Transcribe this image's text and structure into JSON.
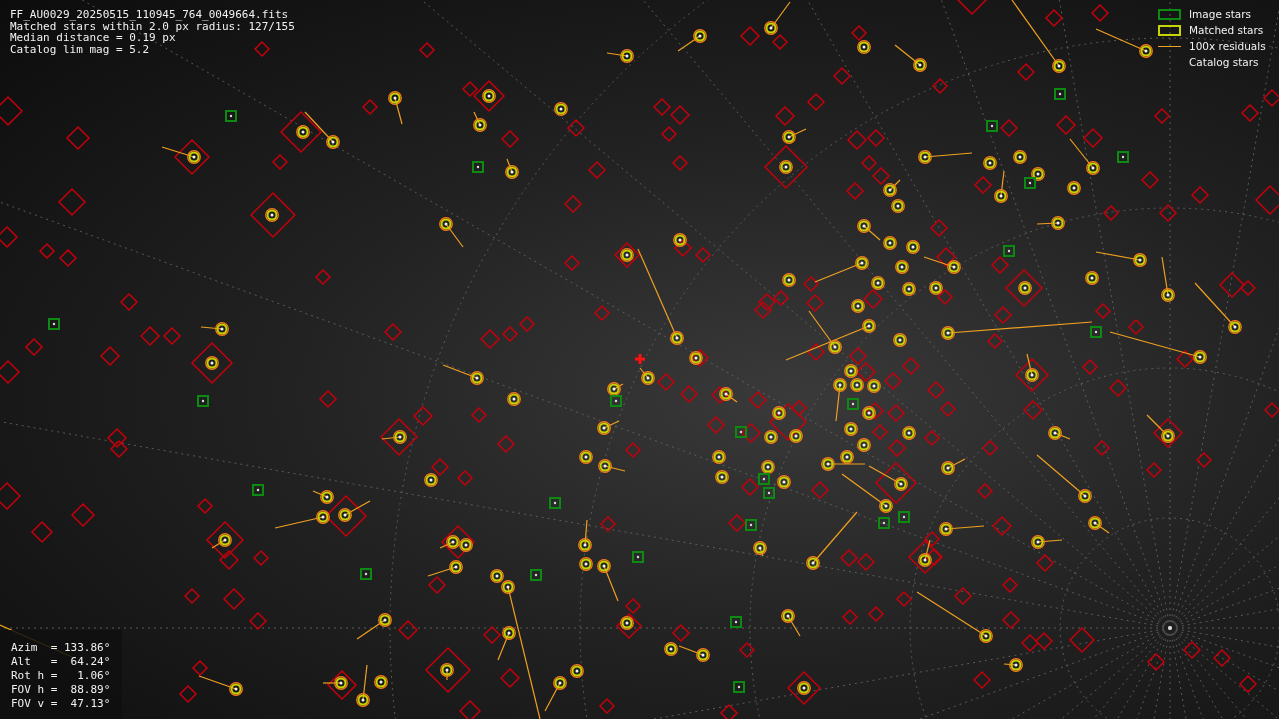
{
  "info_lines": [
    "FF_AU0029_20250515_110945_764_0049664.fits",
    "Matched stars within 2.0 px radius: 127/155",
    "Median distance = 0.19 px",
    "Catalog lim mag = 5.2"
  ],
  "legend": [
    {
      "kind": "image",
      "label": "Image stars"
    },
    {
      "kind": "matched",
      "label": "Matched stars"
    },
    {
      "kind": "residual",
      "label": "100x residuals"
    },
    {
      "kind": "catalog",
      "label": "Catalog stars"
    }
  ],
  "pointing": [
    "Azim  = 133.86°",
    "Alt   =  64.24°",
    "Rot h =   1.06°",
    "FOV h =  88.89°",
    "FOV v =  47.13°"
  ]
}
